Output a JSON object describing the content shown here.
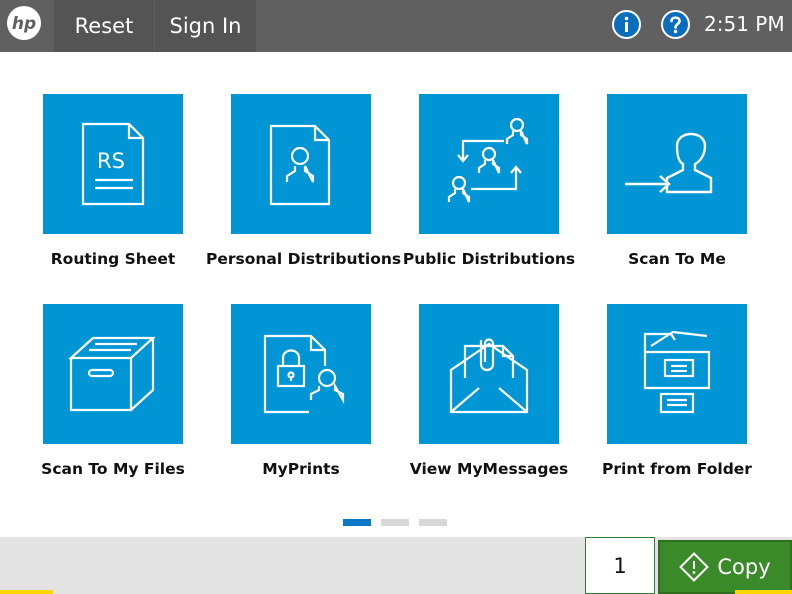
{
  "header": {
    "logo_text": "hp",
    "reset_label": "Reset",
    "signin_label": "Sign In",
    "info_icon": "info-icon",
    "help_icon": "help-icon",
    "time": "2:51 PM"
  },
  "tiles": [
    {
      "label": "Routing Sheet",
      "icon": "routing-sheet-icon",
      "icon_text": "RS"
    },
    {
      "label": "Personal Distributions",
      "icon": "personal-distributions-icon"
    },
    {
      "label": "Public Distributions",
      "icon": "public-distributions-icon"
    },
    {
      "label": "Scan To Me",
      "icon": "scan-to-me-icon"
    },
    {
      "label": "Scan To My Files",
      "icon": "box-icon"
    },
    {
      "label": "MyPrints",
      "icon": "locked-document-icon"
    },
    {
      "label": "View MyMessages",
      "icon": "envelope-icon"
    },
    {
      "label": "Print from Folder",
      "icon": "folder-printer-icon"
    }
  ],
  "pagination": {
    "pages": 3,
    "current": 1
  },
  "footer": {
    "copies_value": "1",
    "copy_label": "Copy"
  },
  "colors": {
    "tile": "#0096d6",
    "topbar": "#606060",
    "copy_button": "#3b8a2a",
    "accent": "#ffd600"
  }
}
